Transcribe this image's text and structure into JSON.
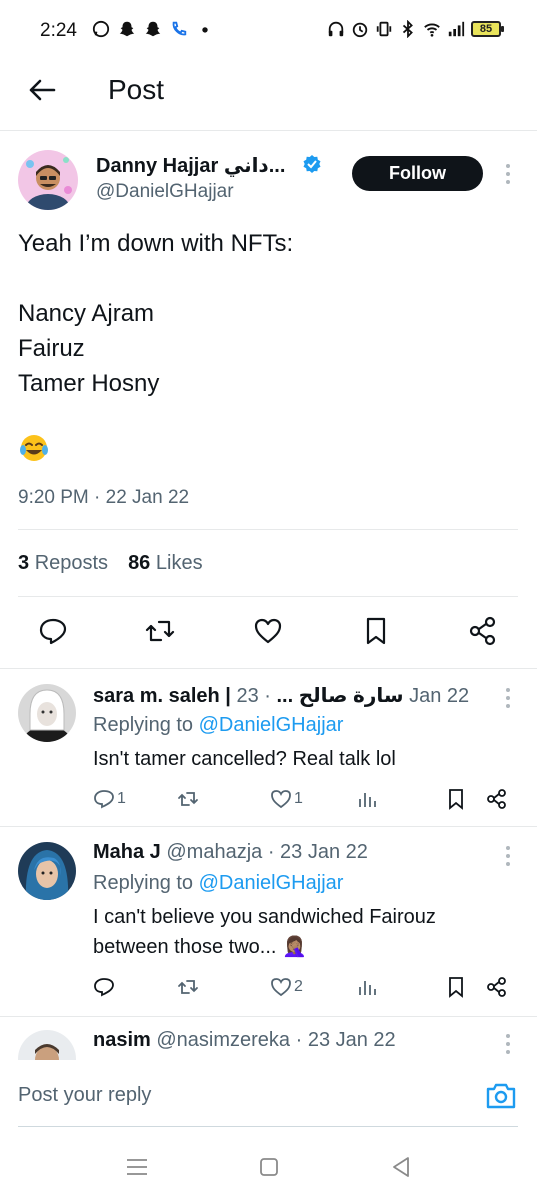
{
  "status_bar": {
    "time": "2:24",
    "battery": "85",
    "left_icons": [
      "whatsapp-icon",
      "snapchat-icon",
      "snapchat-icon",
      "phone-icon",
      "dot-icon"
    ],
    "right_icons": [
      "headphones-icon",
      "alarm-icon",
      "vibrate-icon",
      "bluetooth-icon",
      "wifi-icon",
      "signal-icon",
      "battery-icon"
    ]
  },
  "header": {
    "title": "Post"
  },
  "post": {
    "author_name": "Danny Hajjar داني...",
    "author_handle": "@DanielGHajjar",
    "verified": true,
    "follow_label": "Follow",
    "text_lines": [
      "Yeah I’m down with NFTs:",
      "",
      "Nancy Ajram",
      "Fairuz",
      "Tamer Hosny"
    ],
    "emoji": "😂",
    "timestamp": "9:20 PM · 22 Jan 22",
    "reposts_count": "3",
    "reposts_label": "Reposts",
    "likes_count": "86",
    "likes_label": "Likes",
    "actions": [
      "reply-icon",
      "repost-icon",
      "like-icon",
      "bookmark-icon",
      "share-icon"
    ]
  },
  "replies": [
    {
      "name": "sara m. saleh | سارة صالح ...",
      "meta": " · 23 Jan 22",
      "replying_prefix": "Replying to ",
      "replying_to": "@DanielGHajjar",
      "text_lines": [
        "Isn't tamer cancelled? Real talk lol"
      ],
      "reply_count": "1",
      "repost_count": "",
      "like_count": "1"
    },
    {
      "name": "Maha J",
      "meta": " @mahazja · 23 Jan 22",
      "replying_prefix": "Replying to ",
      "replying_to": "@DanielGHajjar",
      "text_lines": [
        "I can't believe you sandwiched Fairouz",
        "between those two... 🤦🏽‍♀️"
      ],
      "reply_count": "",
      "repost_count": "",
      "like_count": "2"
    },
    {
      "name": "nasim",
      "meta": " @nasimzereka · 23 Jan 22"
    }
  ],
  "composer": {
    "placeholder": "Post your reply"
  },
  "colors": {
    "accent": "#1d9bf0",
    "text": "#0f1419",
    "secondary": "#536471",
    "divider": "#e7e9ea"
  }
}
